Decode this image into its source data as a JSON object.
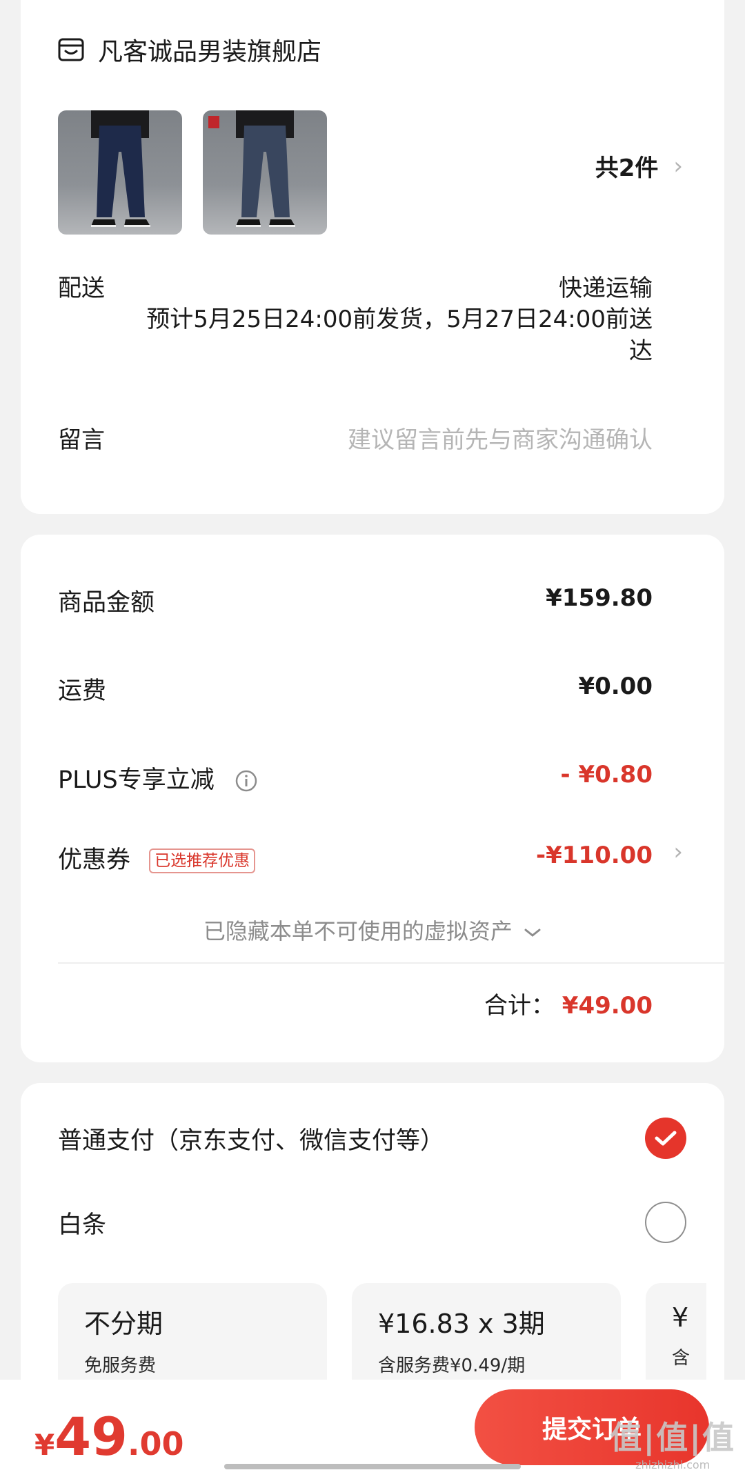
{
  "shop": {
    "name": "凡客诚品男装旗舰店",
    "item_count": "共2件"
  },
  "delivery": {
    "label": "配送",
    "method": "快递运输",
    "estimate": "预计5月25日24:00前发货，5月27日24:00前送达"
  },
  "message": {
    "label": "留言",
    "placeholder": "建议留言前先与商家沟通确认"
  },
  "amounts": {
    "goods_label": "商品金额",
    "goods_value": "¥159.80",
    "shipping_label": "运费",
    "shipping_value": "¥0.00",
    "plus_label": "PLUS专享立减",
    "plus_value": "- ¥0.80",
    "coupon_label": "优惠券",
    "coupon_tag": "已选推荐优惠",
    "coupon_value": "-¥110.00",
    "hidden_assets": "已隐藏本单不可使用的虚拟资产",
    "total_label": "合计：",
    "total_value": "¥49.00"
  },
  "payment": {
    "normal_label": "普通支付（京东支付、微信支付等）",
    "baitiao_label": "白条",
    "plans": [
      {
        "title": "不分期",
        "sub": "免服务费"
      },
      {
        "title": "¥16.83 x 3期",
        "sub": "含服务费¥0.49/期"
      },
      {
        "title": "¥",
        "sub": "含"
      }
    ]
  },
  "bottom": {
    "currency": "¥",
    "integer": "49",
    "decimal": ".00",
    "submit_label": "提交订单",
    "watermark": "值|值|值",
    "watermark_sub": "zhizhizhi.com"
  },
  "colors": {
    "accent": "#e5352b",
    "price_red": "#d9362b"
  }
}
